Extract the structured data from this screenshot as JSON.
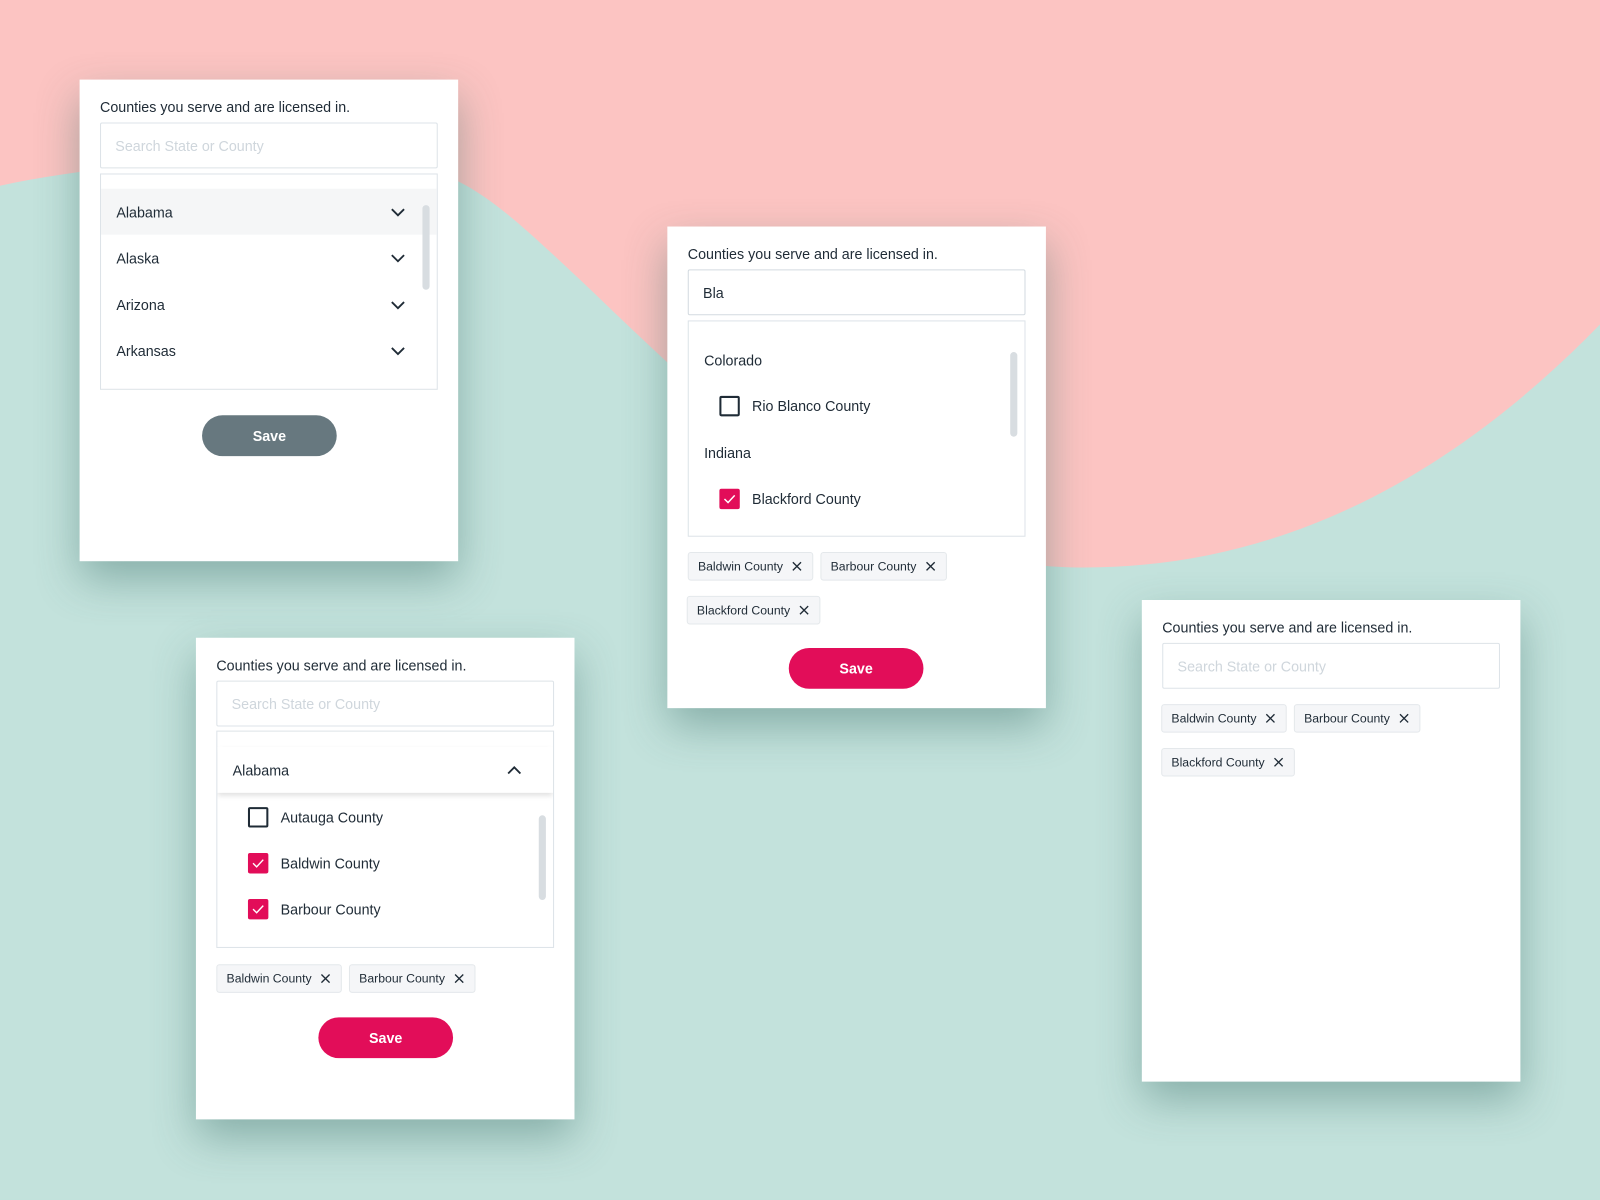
{
  "colors": {
    "background_top": "#fcc4c2",
    "background_bottom": "#c3e2dc",
    "accent": "#e20d59",
    "save_disabled": "#67787f"
  },
  "label": "Counties you serve and are licensed in.",
  "search_placeholder": "Search State or County",
  "save_label": "Save",
  "card1": {
    "states": [
      "Alabama",
      "Alaska",
      "Arizona",
      "Arkansas"
    ]
  },
  "card2": {
    "search_value": "Bla",
    "groups": [
      {
        "state": "Colorado",
        "counties": [
          {
            "name": "Rio Blanco County",
            "checked": false
          }
        ]
      },
      {
        "state": "Indiana",
        "counties": [
          {
            "name": "Blackford County",
            "checked": true
          }
        ]
      }
    ],
    "tags": [
      "Baldwin County",
      "Barbour County",
      "Blackford County"
    ]
  },
  "card3": {
    "state": "Alabama",
    "counties": [
      {
        "name": "Autauga County",
        "checked": false
      },
      {
        "name": "Baldwin County",
        "checked": true
      },
      {
        "name": "Barbour County",
        "checked": true
      }
    ],
    "tags": [
      "Baldwin County",
      "Barbour County"
    ]
  },
  "card4": {
    "tags": [
      "Baldwin County",
      "Barbour County",
      "Blackford County"
    ]
  }
}
